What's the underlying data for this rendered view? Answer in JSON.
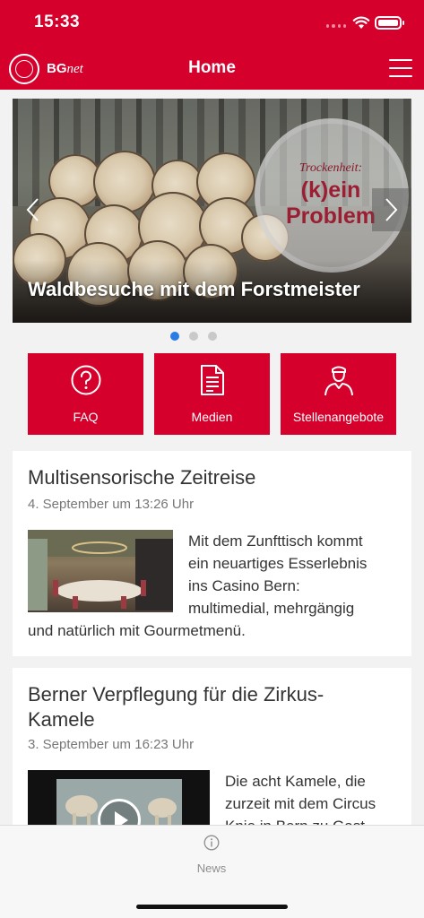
{
  "status_bar": {
    "time": "15:33"
  },
  "nav": {
    "logo_text": "BG",
    "logo_suffix": "net",
    "title": "Home",
    "menu_icon": "hamburger-icon"
  },
  "carousel": {
    "caption": "Waldbesuche mit dem Forstmeister",
    "overlay_kicker": "Trockenheit:",
    "overlay_headline": "(k)ein Problem",
    "prev_icon": "chevron-left-icon",
    "next_icon": "chevron-right-icon",
    "slide_count": 3,
    "active_index": 0
  },
  "tiles": [
    {
      "label": "FAQ",
      "icon": "question-icon"
    },
    {
      "label": "Medien",
      "icon": "document-icon"
    },
    {
      "label": "Stellenangebote",
      "icon": "person-icon"
    }
  ],
  "news": [
    {
      "title": "Multisensorische Zeitreise",
      "date": "4. September um 13:26 Uhr",
      "text_side": [
        "Mit dem Zunfttisch kommt",
        "ein neuartiges Esserlebnis",
        "ins Casino Bern:",
        "multimedial, mehrgängig"
      ],
      "text_full": "und natürlich mit Gourmetmenü."
    },
    {
      "title_line1": "Berner Verpflegung für die Zirkus-",
      "title_line2": "Kamele",
      "date": "3. September um 16:23 Uhr",
      "text_side": [
        "Die acht Kamele, die",
        "zurzeit mit dem Circus",
        "Knie in Bern zu Gast"
      ],
      "video_icon": "play-icon"
    }
  ],
  "tab_bar": {
    "items": [
      {
        "label": "News",
        "icon": "info-icon"
      }
    ]
  },
  "colors": {
    "brand_red": "#d5002b",
    "dot_active": "#2a7be4"
  }
}
